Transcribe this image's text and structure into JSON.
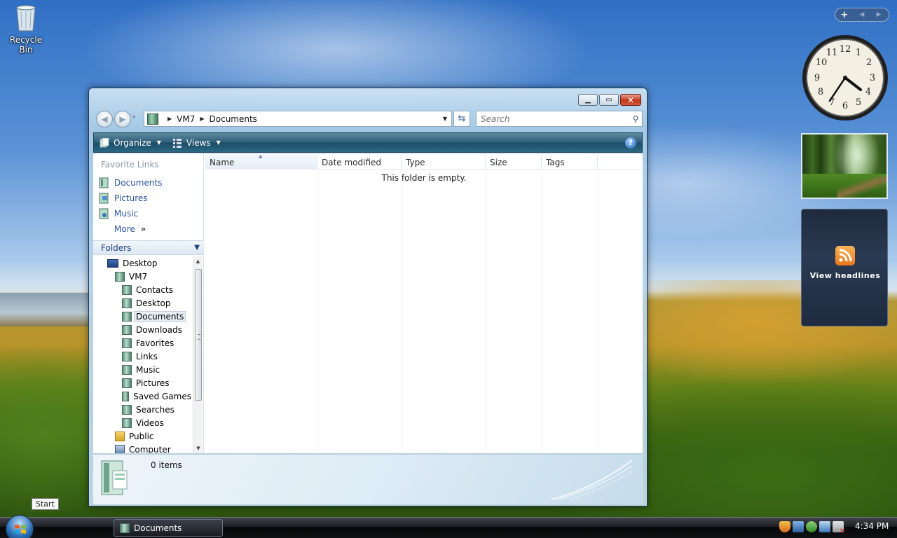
{
  "desktop": {
    "recycle_bin_label": "Recycle Bin"
  },
  "window": {
    "address": {
      "crumbs": [
        "VM7",
        "Documents"
      ]
    },
    "search_placeholder": "Search",
    "toolbar": {
      "organize_label": "Organize",
      "views_label": "Views"
    },
    "favorite_links": {
      "title": "Favorite Links",
      "items": [
        {
          "label": "Documents",
          "icon": "documents-icon"
        },
        {
          "label": "Pictures",
          "icon": "pictures-icon"
        },
        {
          "label": "Music",
          "icon": "music-icon"
        }
      ],
      "more_label": "More"
    },
    "folders": {
      "header": "Folders",
      "tree": [
        {
          "label": "Desktop",
          "level": 1,
          "icon": "desktop-icon"
        },
        {
          "label": "VM7",
          "level": 2,
          "icon": "user-folder-icon"
        },
        {
          "label": "Contacts",
          "level": 3,
          "icon": "contacts-icon"
        },
        {
          "label": "Desktop",
          "level": 3,
          "icon": "desktop-folder-icon"
        },
        {
          "label": "Documents",
          "level": 3,
          "icon": "documents-icon",
          "selected": true
        },
        {
          "label": "Downloads",
          "level": 3,
          "icon": "downloads-icon"
        },
        {
          "label": "Favorites",
          "level": 3,
          "icon": "favorites-icon"
        },
        {
          "label": "Links",
          "level": 3,
          "icon": "links-icon"
        },
        {
          "label": "Music",
          "level": 3,
          "icon": "music-icon"
        },
        {
          "label": "Pictures",
          "level": 3,
          "icon": "pictures-icon"
        },
        {
          "label": "Saved Games",
          "level": 3,
          "icon": "saved-games-icon"
        },
        {
          "label": "Searches",
          "level": 3,
          "icon": "searches-icon"
        },
        {
          "label": "Videos",
          "level": 3,
          "icon": "videos-icon"
        },
        {
          "label": "Public",
          "level": 2,
          "icon": "public-folder-icon"
        },
        {
          "label": "Computer",
          "level": 2,
          "icon": "computer-icon"
        }
      ]
    },
    "columns": [
      "Name",
      "Date modified",
      "Type",
      "Size",
      "Tags"
    ],
    "empty_message": "This folder is empty.",
    "details": {
      "item_count": "0 items"
    }
  },
  "gadgets": {
    "feed_label": "View headlines"
  },
  "taskbar": {
    "start_tooltip": "Start",
    "task_button_label": "Documents",
    "time": "4:34 PM"
  },
  "colors": {
    "link_blue": "#2a55a0",
    "toolbar_dark": "#1c4c66",
    "close_red": "#c0381c"
  }
}
